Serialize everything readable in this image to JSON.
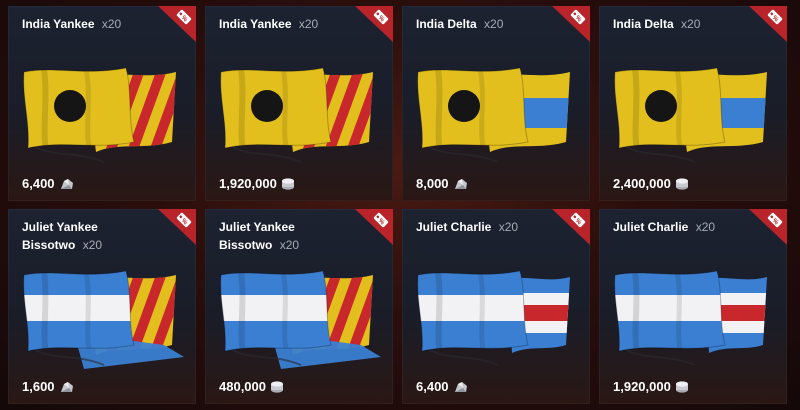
{
  "colors": {
    "badge_red": "#b8242a",
    "flag_yellow": "#e2bf1c",
    "flag_blue": "#3a7fd2",
    "flag_red": "#c8282b"
  },
  "items": [
    {
      "name": "India Yankee",
      "bissotwo": "",
      "qty": "x20",
      "price": "6,400",
      "currency_icon": "coal-icon",
      "flag": "india-yankee",
      "sale_icon": "discount-tag-icon"
    },
    {
      "name": "India Yankee",
      "bissotwo": "",
      "qty": "x20",
      "price": "1,920,000",
      "currency_icon": "credits-icon",
      "flag": "india-yankee",
      "sale_icon": "discount-tag-icon"
    },
    {
      "name": "India Delta",
      "bissotwo": "",
      "qty": "x20",
      "price": "8,000",
      "currency_icon": "coal-icon",
      "flag": "india-delta",
      "sale_icon": "discount-tag-icon"
    },
    {
      "name": "India Delta",
      "bissotwo": "",
      "qty": "x20",
      "price": "2,400,000",
      "currency_icon": "credits-icon",
      "flag": "india-delta",
      "sale_icon": "discount-tag-icon"
    },
    {
      "name": "Juliet Yankee",
      "bissotwo": "Bissotwo",
      "qty": "x20",
      "price": "1,600",
      "currency_icon": "coal-icon",
      "flag": "juliet-yankee-bissotwo",
      "sale_icon": "discount-tag-icon"
    },
    {
      "name": "Juliet Yankee",
      "bissotwo": "Bissotwo",
      "qty": "x20",
      "price": "480,000",
      "currency_icon": "credits-icon",
      "flag": "juliet-yankee-bissotwo",
      "sale_icon": "discount-tag-icon"
    },
    {
      "name": "Juliet Charlie",
      "bissotwo": "",
      "qty": "x20",
      "price": "6,400",
      "currency_icon": "coal-icon",
      "flag": "juliet-charlie",
      "sale_icon": "discount-tag-icon"
    },
    {
      "name": "Juliet Charlie",
      "bissotwo": "",
      "qty": "x20",
      "price": "1,920,000",
      "currency_icon": "credits-icon",
      "flag": "juliet-charlie",
      "sale_icon": "discount-tag-icon"
    }
  ]
}
